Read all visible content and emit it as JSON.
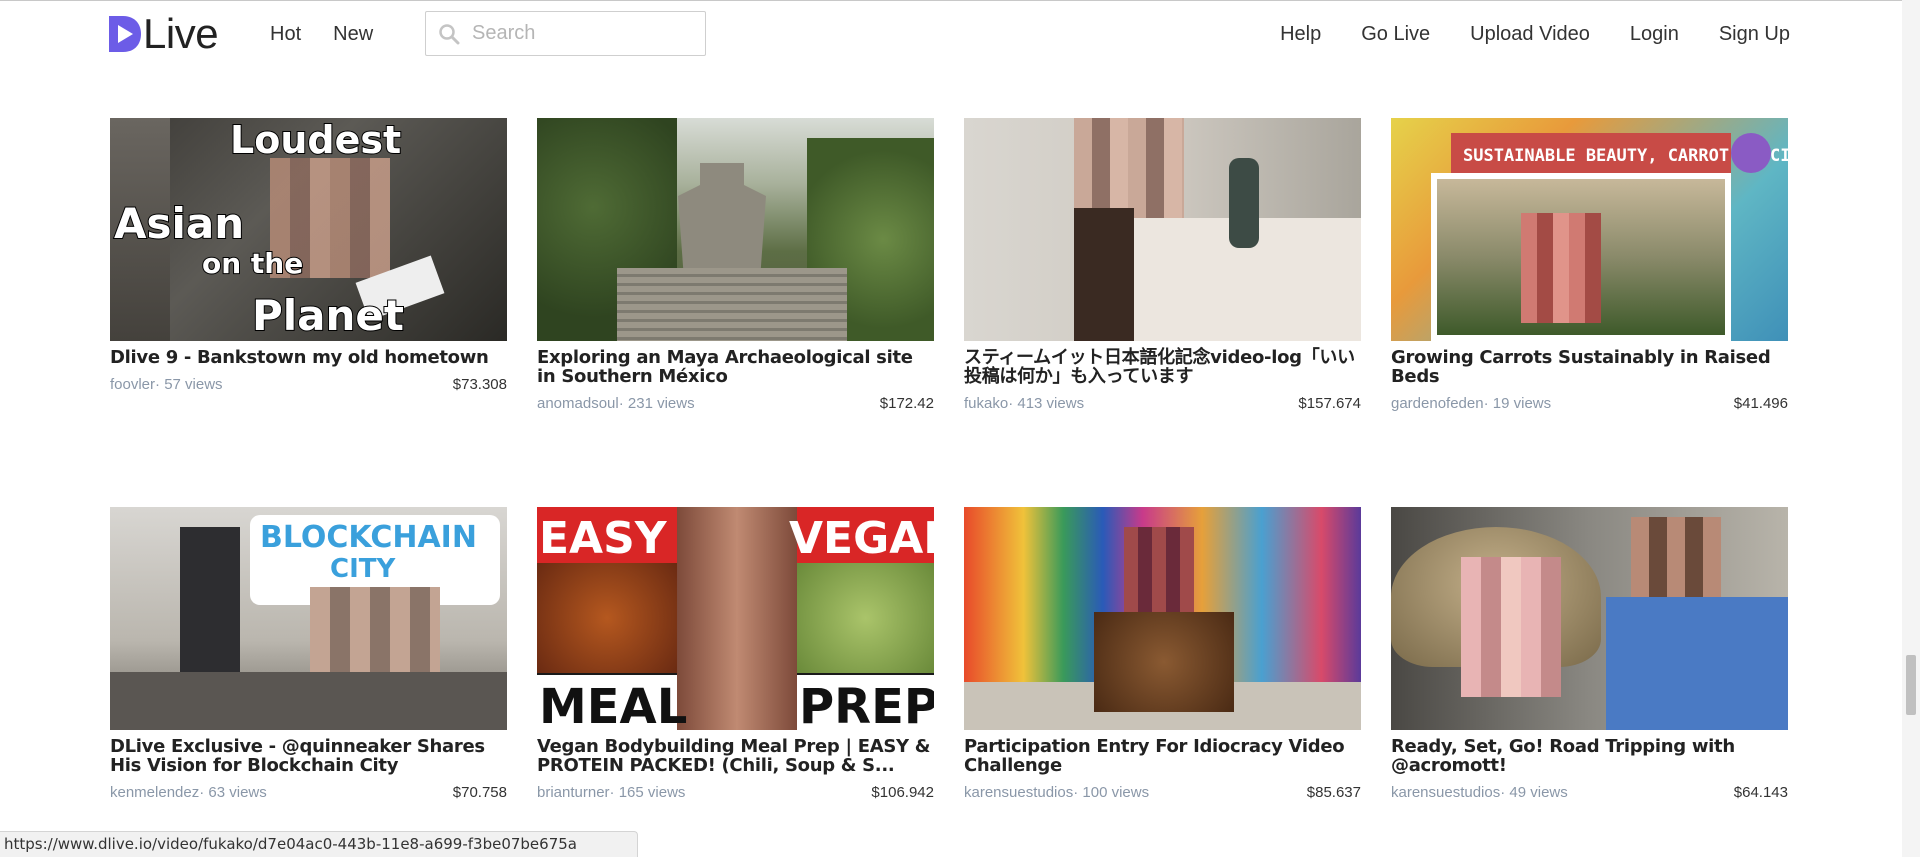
{
  "header": {
    "logo_text": "Live",
    "nav_left": [
      "Hot",
      "New"
    ],
    "search_placeholder": "Search",
    "nav_right": [
      "Help",
      "Go Live",
      "Upload Video",
      "Login",
      "Sign Up"
    ],
    "brand_color": "#6c5ce7"
  },
  "videos": [
    {
      "title": "Dlive 9 - Bankstown my old hometown",
      "author": "foovler",
      "views": "· 57 views",
      "amount": "$73.308",
      "thumb_text": [
        "Loudest",
        "Asian",
        "on the",
        "Planet"
      ]
    },
    {
      "title": "Exploring an Maya Archaeological site in Southern México",
      "author": "anomadsoul",
      "views": "· 231 views",
      "amount": "$172.42"
    },
    {
      "title": "スティームイット日本語化記念video-log「いい投稿は何か」も入っています",
      "author": "fukako",
      "views": "· 413 views",
      "amount": "$157.674"
    },
    {
      "title": "Growing Carrots Sustainably in Raised Beds",
      "author": "gardenofeden",
      "views": "· 19 views",
      "amount": "$41.496",
      "thumb_text": [
        "SUSTAINABLE BEAUTY, CARROT SPECIAL"
      ]
    },
    {
      "title": "DLive Exclusive - @quinneaker Shares His Vision for Blockchain City",
      "author": "kenmelendez",
      "views": "· 63 views",
      "amount": "$70.758",
      "thumb_text": [
        "BLOCKCHAIN",
        "CITY"
      ]
    },
    {
      "title": "Vegan Bodybuilding Meal Prep | EASY & PROTEIN PACKED! (Chili, Soup & S...",
      "author": "brianturner",
      "views": "· 165 views",
      "amount": "$106.942",
      "thumb_text": [
        "EASY",
        "VEGAN",
        "MEAL",
        "PREP"
      ]
    },
    {
      "title": "Participation Entry For Idiocracy Video Challenge",
      "author": "karensuestudios",
      "views": "· 100 views",
      "amount": "$85.637"
    },
    {
      "title": "Ready, Set, Go! Road Tripping with @acromott!",
      "author": "karensuestudios",
      "views": "· 49 views",
      "amount": "$64.143"
    }
  ],
  "status_url": "https://www.dlive.io/video/fukako/d7e04ac0-443b-11e8-a699-f3be07be675a"
}
